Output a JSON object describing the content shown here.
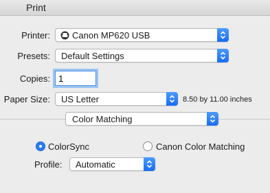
{
  "window": {
    "title": "Print"
  },
  "printer": {
    "label": "Printer:",
    "value": "Canon MP620 USB",
    "icon": "printer-icon"
  },
  "presets": {
    "label": "Presets:",
    "value": "Default Settings"
  },
  "copies": {
    "label": "Copies:",
    "value": "1"
  },
  "paper_size": {
    "label": "Paper Size:",
    "value": "US Letter",
    "dimensions": "8.50 by 11.00 inches"
  },
  "section": {
    "value": "Color Matching"
  },
  "color_matching": {
    "options": [
      {
        "label": "ColorSync",
        "selected": true
      },
      {
        "label": "Canon Color Matching",
        "selected": false
      }
    ],
    "profile": {
      "label": "Profile:",
      "value": "Automatic"
    }
  },
  "colors": {
    "accent": "#1a6cf0",
    "background": "#ececec"
  }
}
